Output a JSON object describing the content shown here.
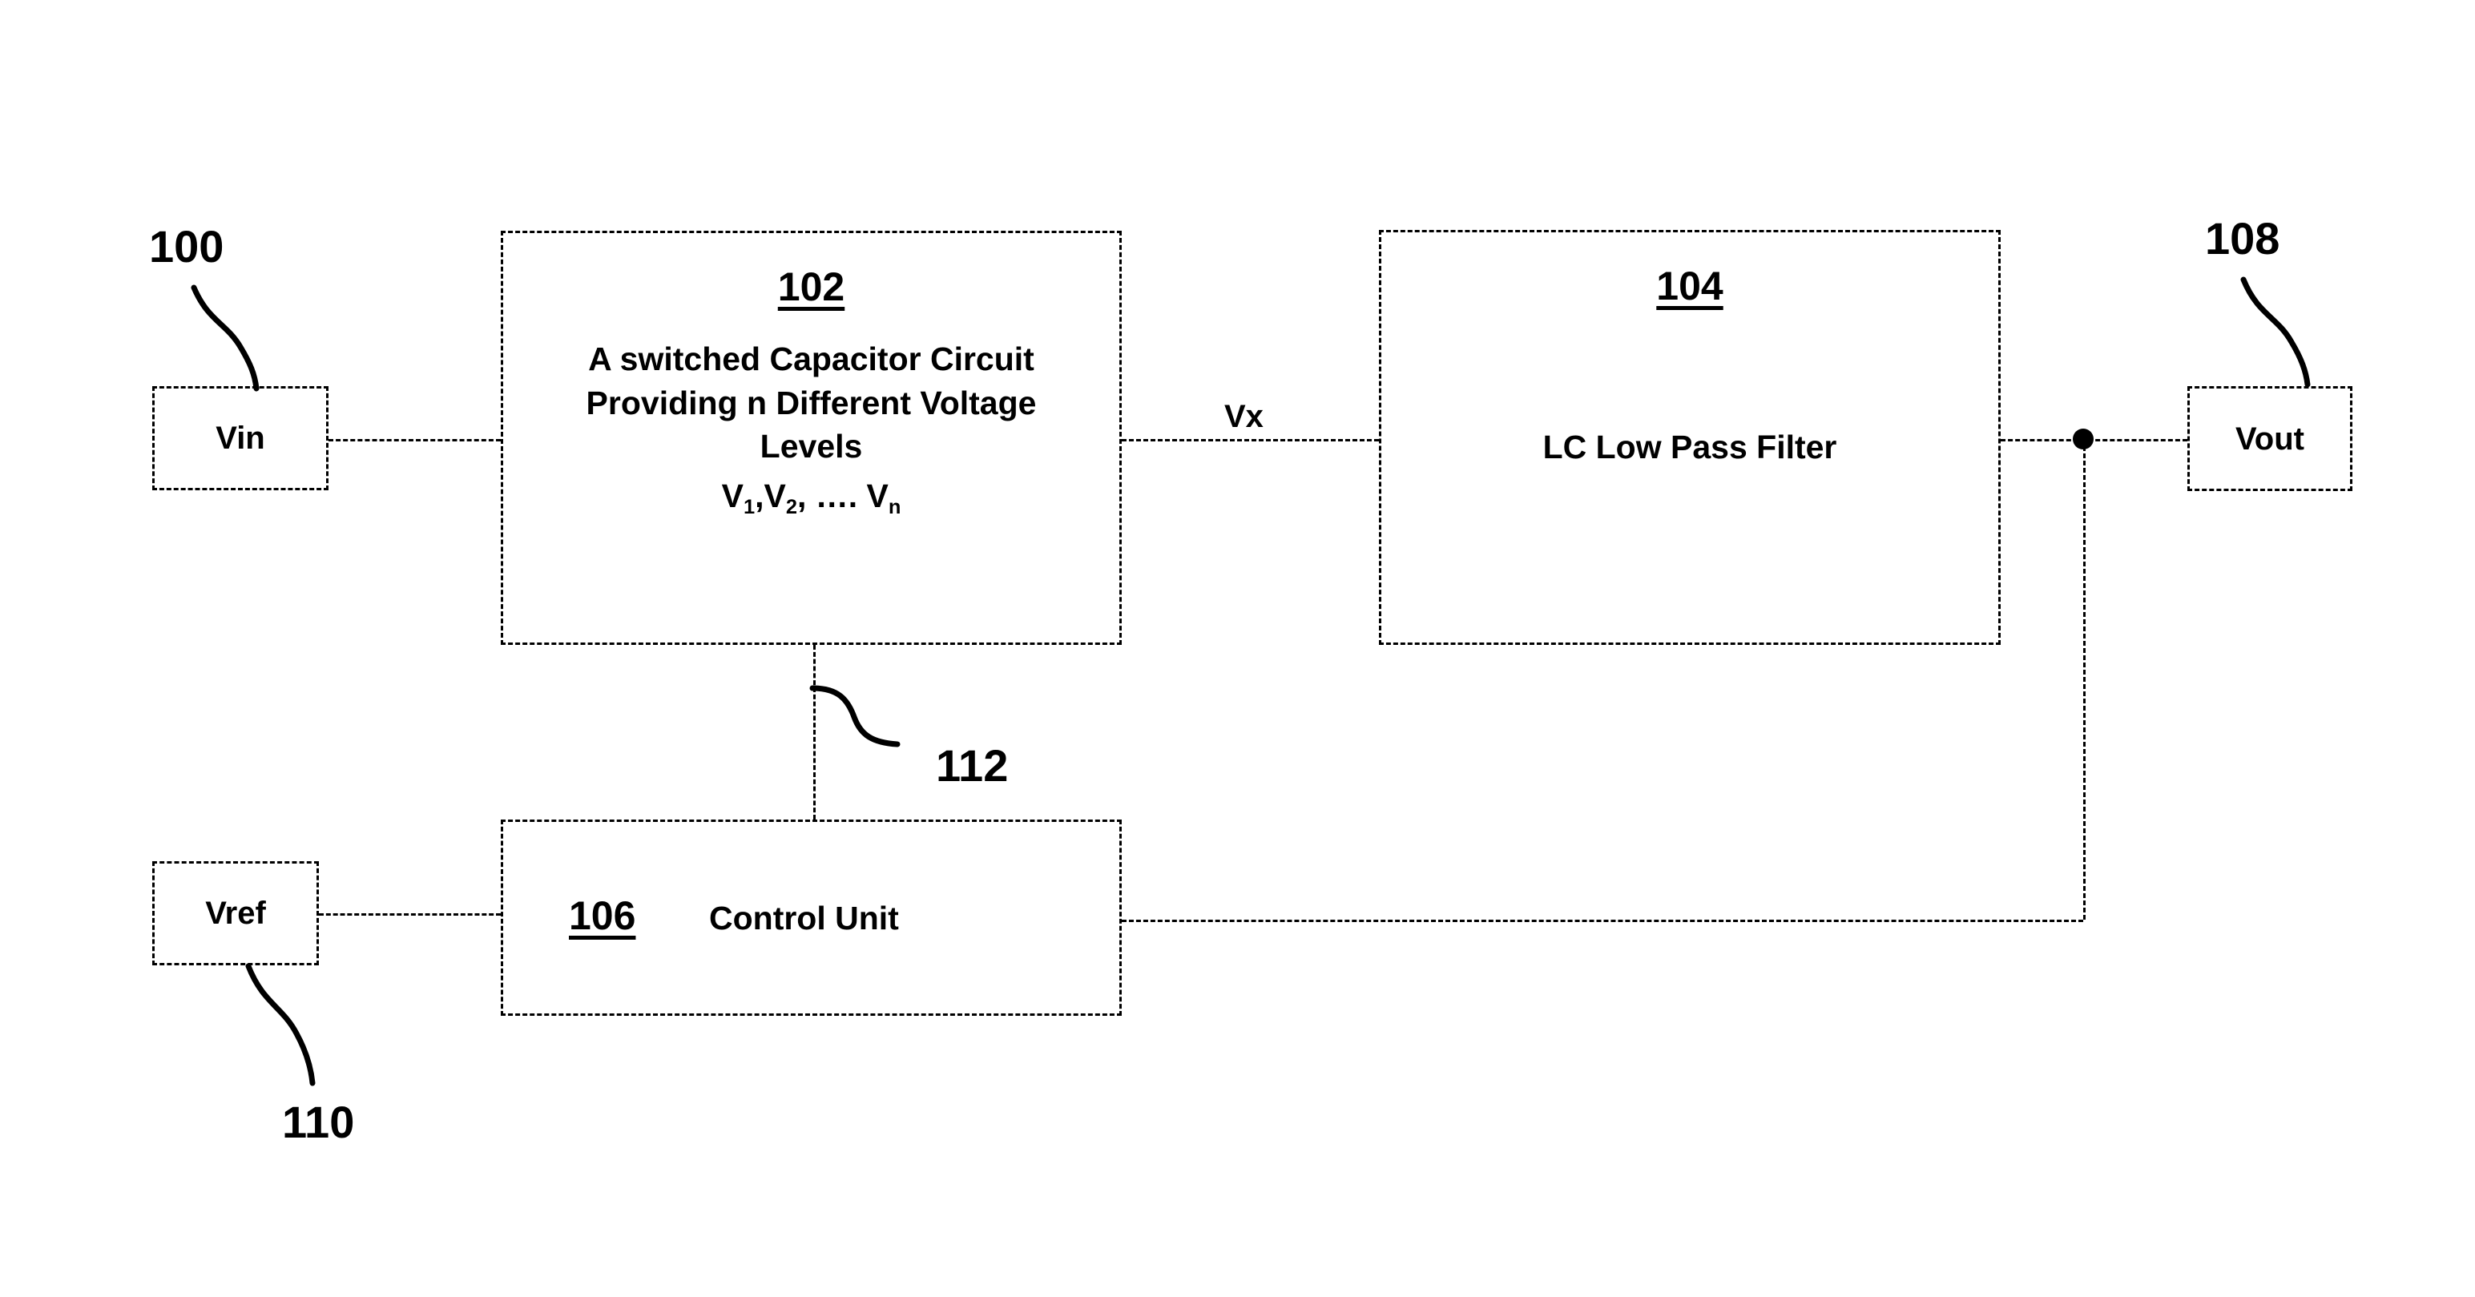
{
  "figure": {
    "kind": "patent-block-diagram",
    "background": "#ffffff",
    "line_color": "#000000"
  },
  "io_blocks": {
    "vin": {
      "label": "Vin"
    },
    "vout": {
      "label": "Vout"
    },
    "vref": {
      "label": "Vref"
    }
  },
  "functional_blocks": {
    "switched_capacitor": {
      "number": "102",
      "line1": "A switched Capacitor Circuit",
      "line2": "Providing n Different Voltage",
      "line3": "Levels",
      "levels_prefix": "V",
      "levels_sub1": "1",
      "levels_mid": ",V",
      "levels_sub2": "2",
      "levels_tail": ", …. V",
      "levels_subn": "n"
    },
    "filter": {
      "number": "104",
      "text": "LC Low Pass Filter"
    },
    "control_unit": {
      "number": "106",
      "text": "Control Unit"
    }
  },
  "signals": {
    "vx": "Vx"
  },
  "reference_numerals": {
    "system": "100",
    "output": "108",
    "reference": "110",
    "control_link": "112"
  }
}
